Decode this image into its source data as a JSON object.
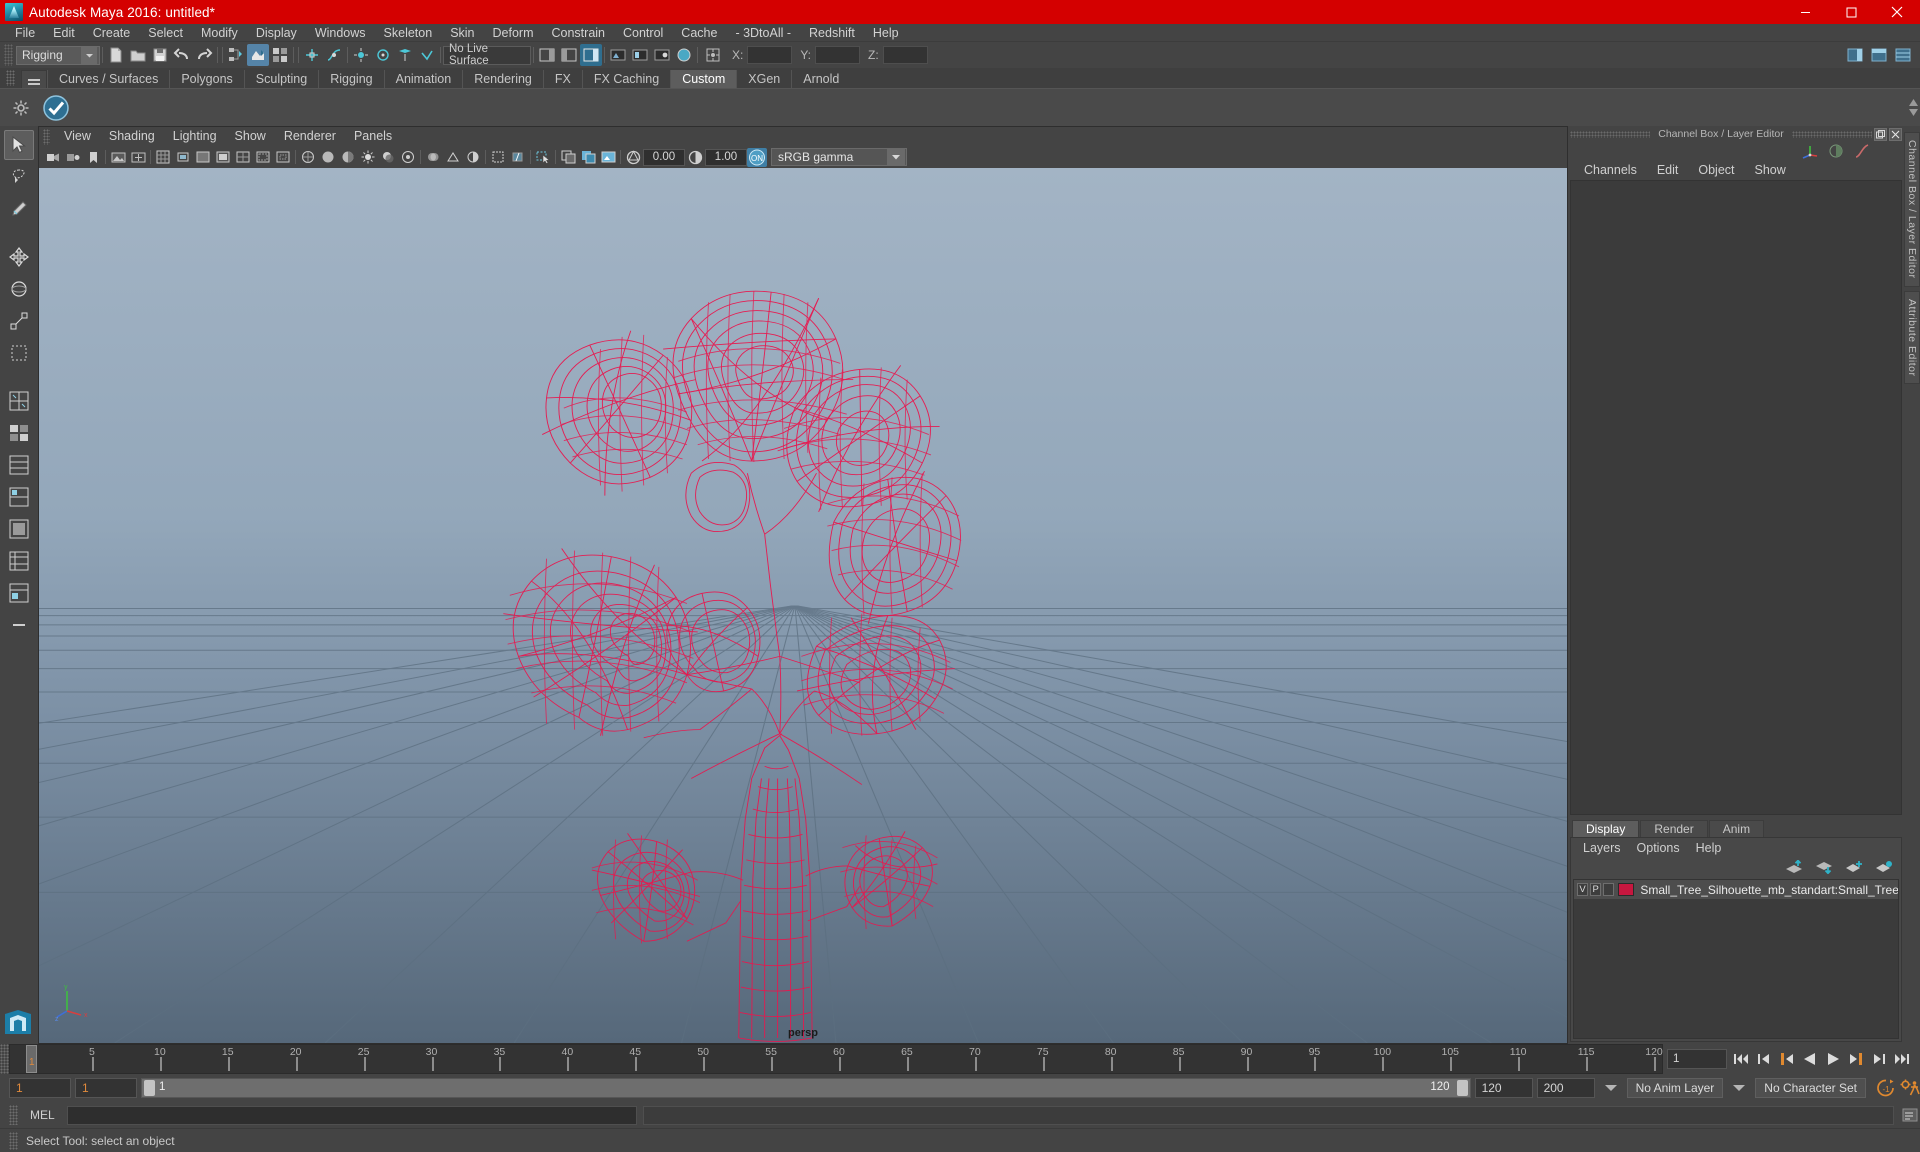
{
  "window": {
    "title": "Autodesk Maya 2016: untitled*",
    "logo_icon": "maya-logo-icon",
    "buttons": [
      {
        "name": "minimize-button",
        "glyph": "minimize-icon"
      },
      {
        "name": "maximize-button",
        "glyph": "maximize-icon"
      },
      {
        "name": "close-button",
        "glyph": "close-icon"
      }
    ],
    "titlebar_color": "#d40000"
  },
  "menubar": {
    "items": [
      "File",
      "Edit",
      "Create",
      "Select",
      "Modify",
      "Display",
      "Windows",
      "Skeleton",
      "Skin",
      "Deform",
      "Constrain",
      "Control",
      "Cache",
      "- 3DtoAll -",
      "Redshift",
      "Help"
    ]
  },
  "statusline": {
    "menuset": "Rigging",
    "live_surface": "No Live Surface",
    "coords": {
      "x_label": "X:",
      "y_label": "Y:",
      "z_label": "Z:",
      "x": "",
      "y": "",
      "z": ""
    }
  },
  "shelf": {
    "tabs": [
      "Curves / Surfaces",
      "Polygons",
      "Sculpting",
      "Rigging",
      "Animation",
      "Rendering",
      "FX",
      "FX Caching",
      "Custom",
      "XGen",
      "Arnold"
    ],
    "active_tab": "Custom"
  },
  "viewport": {
    "menus": [
      "View",
      "Shading",
      "Lighting",
      "Show",
      "Renderer",
      "Panels"
    ],
    "exposure": "0.00",
    "gamma": "1.00",
    "color_profile": "sRGB gamma",
    "camera_label": "persp",
    "axis": {
      "x": "x",
      "y": "y",
      "z": "z"
    },
    "model_color": "#e8174e",
    "bg_top": "#9fb0c2",
    "bg_bottom": "#5f7183"
  },
  "channelbox": {
    "dock_title": "Channel Box / Layer Editor",
    "menus": [
      "Channels",
      "Edit",
      "Object",
      "Show"
    ]
  },
  "layer_editor": {
    "tabs": [
      "Display",
      "Render",
      "Anim"
    ],
    "active_tab": "Display",
    "menus": [
      "Layers",
      "Options",
      "Help"
    ],
    "layers": [
      {
        "visibility": "V",
        "playback": "P",
        "state": "",
        "color": "#c6173f",
        "name": "Small_Tree_Silhouette_mb_standart:Small_Tree_Silhouett"
      }
    ]
  },
  "right_tabs": [
    "Channel Box / Layer Editor",
    "Attribute Editor"
  ],
  "timeline": {
    "ticks": [
      5,
      10,
      15,
      20,
      25,
      30,
      35,
      40,
      45,
      50,
      55,
      60,
      65,
      70,
      75,
      80,
      85,
      90,
      95,
      100,
      105,
      110,
      115,
      120
    ],
    "current_frame": "1",
    "current_frame_field": "1",
    "playback_buttons": [
      "go-to-start-icon",
      "step-back-keyframe-icon",
      "step-back-frame-icon",
      "play-backwards-icon",
      "play-forwards-icon",
      "step-forward-frame-icon",
      "step-forward-keyframe-icon",
      "go-to-end-icon"
    ]
  },
  "rangebar": {
    "range_start": "1",
    "anim_start": "1",
    "slider_start": "1",
    "slider_end": "120",
    "anim_end": "120",
    "range_end": "200",
    "anim_layer": "No Anim Layer",
    "character_set": "No Character Set",
    "auto_key_icon": "auto-keyframe-icon",
    "anim_prefs_icon": "animation-preferences-icon"
  },
  "commandline": {
    "label": "MEL",
    "input": "",
    "output": ""
  },
  "helpline": {
    "text": "Select Tool: select an object"
  },
  "toolbox": {
    "tools": [
      "select-tool",
      "lasso-select-tool",
      "paint-select-tool",
      "move-tool",
      "rotate-tool",
      "scale-tool",
      "last-tool-used",
      "four-view-layout",
      "two-panes-stacked-layout",
      "three-panes-layout",
      "single-perspective-layout",
      "persp-outliner-layout",
      "hypergraph-layout",
      "outliner-persp-layout",
      "collapse-layout"
    ]
  }
}
